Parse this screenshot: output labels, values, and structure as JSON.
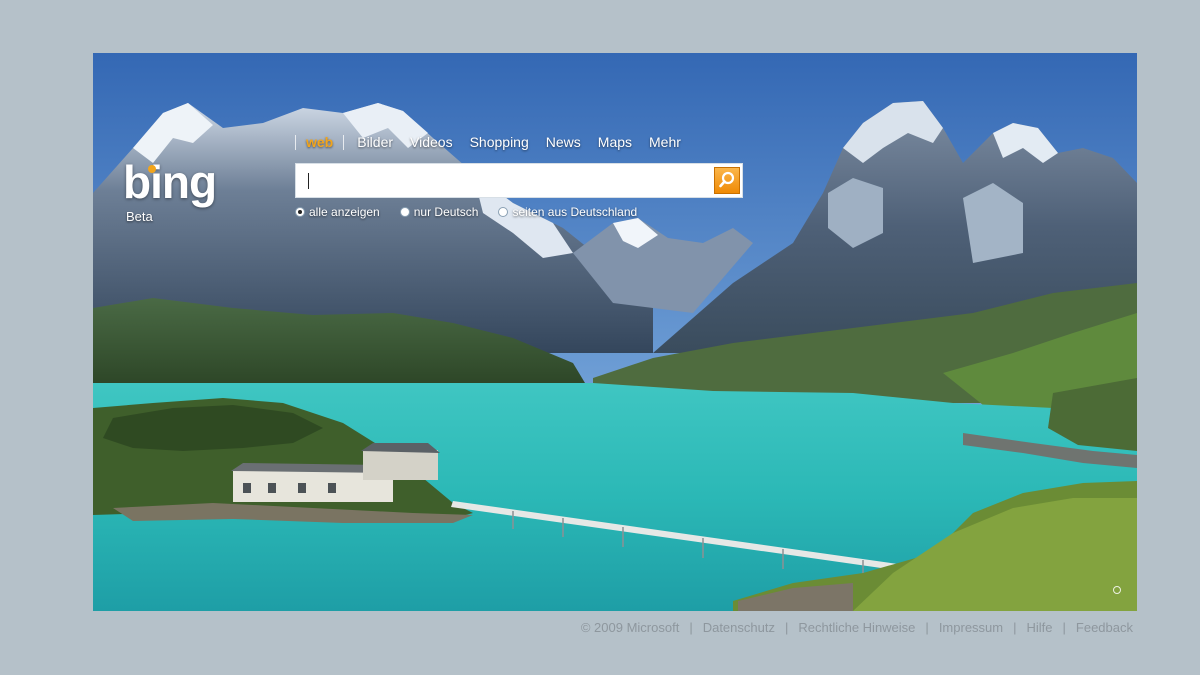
{
  "logo": {
    "text": "bing",
    "beta": "Beta"
  },
  "nav": {
    "items": [
      {
        "label": "web",
        "active": true
      },
      {
        "label": "Bilder"
      },
      {
        "label": "Videos"
      },
      {
        "label": "Shopping"
      },
      {
        "label": "News"
      },
      {
        "label": "Maps"
      },
      {
        "label": "Mehr"
      }
    ]
  },
  "search": {
    "value": "",
    "placeholder": "",
    "button_icon": "magnifier-icon"
  },
  "scope": {
    "options": [
      {
        "label": "alle anzeigen",
        "checked": true
      },
      {
        "label": "nur Deutsch",
        "checked": false
      },
      {
        "label": "seiten aus Deutschland",
        "checked": false
      }
    ]
  },
  "footer": {
    "copyright": "© 2009 Microsoft",
    "links": [
      "Datenschutz",
      "Rechtliche Hinweise",
      "Impressum",
      "Hilfe",
      "Feedback"
    ]
  },
  "colors": {
    "accent": "#f2a51c",
    "page_background": "#b5c1c9",
    "footer_text": "#8e979e",
    "lake": "#2bbcb9"
  }
}
